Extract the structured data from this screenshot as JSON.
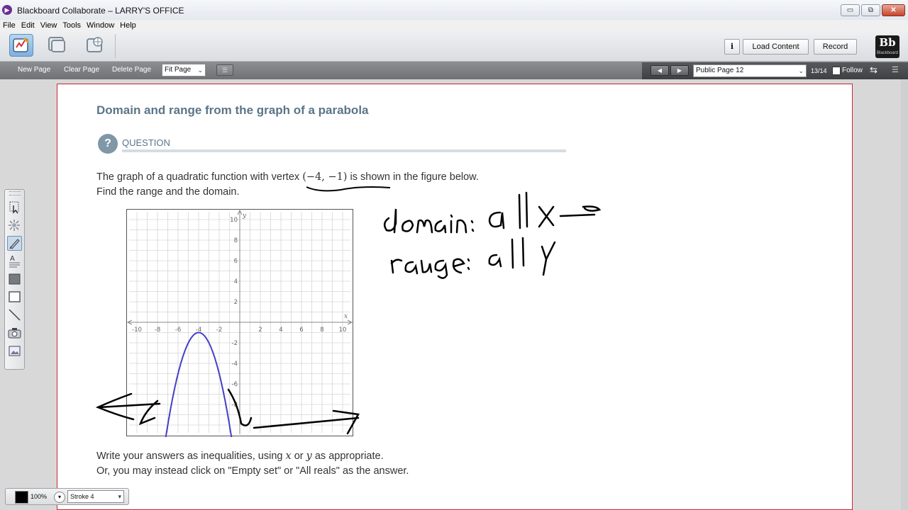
{
  "window": {
    "title": "Blackboard Collaborate – LARRY'S OFFICE",
    "min": "▭",
    "max": "⧉",
    "close": "✕"
  },
  "menu": [
    "File",
    "Edit",
    "View",
    "Tools",
    "Window",
    "Help"
  ],
  "toolbar": {
    "info_label": "i",
    "load_content": "Load Content",
    "record": "Record",
    "logo_text": "Bb",
    "logo_sub": "Blackboard"
  },
  "subbar": {
    "new_page": "New Page",
    "clear_page": "Clear Page",
    "delete_page": "Delete Page",
    "zoom": "Fit Page",
    "page_select": "Public Page 12",
    "page_count": "13/14",
    "follow": "Follow"
  },
  "content": {
    "heading": "Domain and range from the graph of a parabola",
    "question_icon": "?",
    "question_label": "QUESTION",
    "line1_a": "The graph of a quadratic function with ",
    "line1_vertex_word": "vertex",
    "line1_vertex": "(−4, −1)",
    "line1_b": " is shown in the figure below.",
    "line2": "Find the range and the domain.",
    "line3_a": "Write your answers as inequalities, using ",
    "line3_x": "x",
    "line3_or": " or ",
    "line3_y": "y",
    "line3_b": " as appropriate.",
    "line4": "Or, you may instead click on \"Empty set\" or \"All reals\" as the answer."
  },
  "graph": {
    "x_axis_label": "x",
    "y_axis_label": "y",
    "x_ticks": [
      "-10",
      "-8",
      "-6",
      "-4",
      "-2",
      "2",
      "4",
      "6",
      "8",
      "10"
    ],
    "y_ticks_pos": [
      "10",
      "8",
      "6",
      "4",
      "2"
    ],
    "y_ticks_neg": [
      "-2",
      "-4",
      "-6",
      "-8"
    ],
    "curve_color": "#4040c8"
  },
  "handwriting": {
    "domain": "domain: all x",
    "range": "range: all y",
    "ink_color": "#000000"
  },
  "bottom_tool": {
    "zoom": "100%",
    "stroke": "Stroke 4"
  }
}
